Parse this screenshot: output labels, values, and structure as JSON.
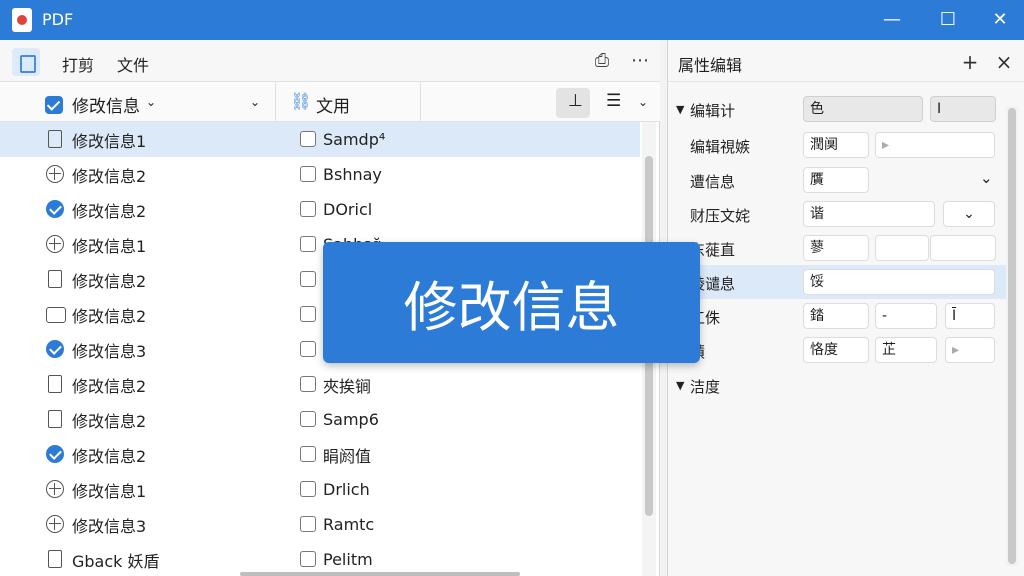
{
  "window": {
    "title": "PDF"
  },
  "toolbar": {
    "menu": [
      "打剪",
      "文件"
    ]
  },
  "columns": {
    "name": "修改信息",
    "value": "文用"
  },
  "rows": [
    {
      "icon": "file",
      "label": "修改信息1",
      "value": "Samdp⁴",
      "selected": true
    },
    {
      "icon": "globe",
      "label": "修改信息2",
      "value": "Bshnay"
    },
    {
      "icon": "check",
      "label": "修改信息2",
      "value": "DOricl"
    },
    {
      "icon": "globe",
      "label": "修改信息1",
      "value": "Sahhşğ"
    },
    {
      "icon": "file",
      "label": "修改信息2",
      "value": ""
    },
    {
      "icon": "folder",
      "label": "修改信息2",
      "value": ""
    },
    {
      "icon": "check",
      "label": "修改信息3",
      "value": ""
    },
    {
      "icon": "file",
      "label": "修改信息2",
      "value": "夾挨锏"
    },
    {
      "icon": "file",
      "label": "修改信息2",
      "value": "Samp6"
    },
    {
      "icon": "check",
      "label": "修改信息2",
      "value": "睊阏值"
    },
    {
      "icon": "globe",
      "label": "修改信息1",
      "value": "Drlich"
    },
    {
      "icon": "globe",
      "label": "修改信息3",
      "value": "Ramtc"
    },
    {
      "icon": "file",
      "label": "Gback 妖盾",
      "value": "Pelitm"
    }
  ],
  "panel": {
    "title": "属性编辑",
    "sections": [
      "编辑计",
      "洁度"
    ],
    "props": [
      {
        "label": "编辑視嫉",
        "fields": [
          "潤阒",
          "▸"
        ]
      },
      {
        "label": "遭信息",
        "fields": [
          "贋"
        ]
      },
      {
        "label": "财压文姹",
        "fields": [
          "谐",
          "",
          "⌄"
        ]
      },
      {
        "label": "东蓰直",
        "fields": [
          "蓼",
          "",
          ""
        ]
      },
      {
        "label": "棱谴息",
        "fields": [
          "馁"
        ]
      },
      {
        "label": "工侏",
        "fields": [
          "錔",
          "-",
          "Ī"
        ]
      },
      {
        "label": "蹟",
        "fields": [
          "恪度",
          "芷",
          "▸"
        ]
      }
    ],
    "section1_fields": [
      "色",
      "I"
    ]
  },
  "toast": {
    "text": "修改信息"
  }
}
